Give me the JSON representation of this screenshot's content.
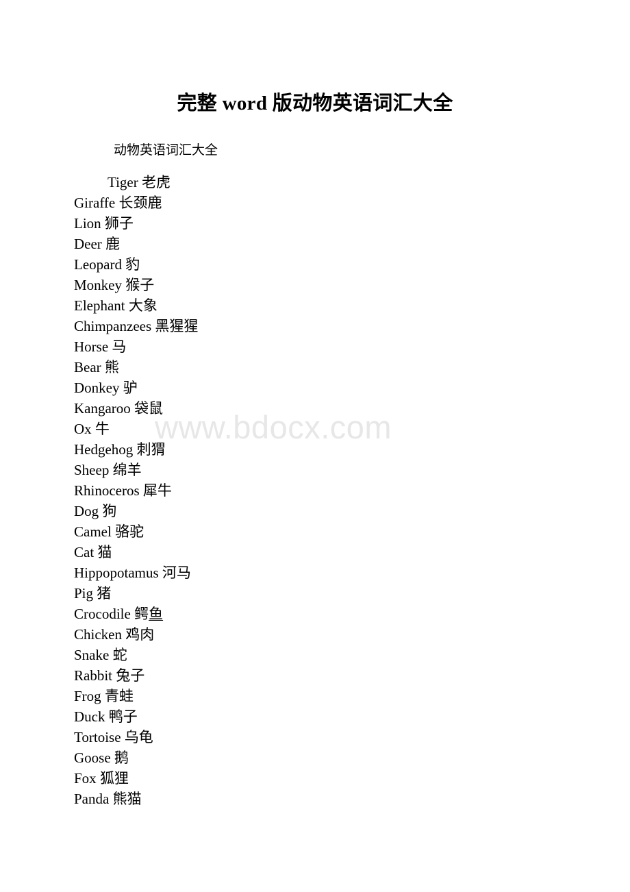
{
  "document": {
    "title": "完整 word 版动物英语词汇大全",
    "subtitle": "动物英语词汇大全",
    "watermark": "www.bdocx.com",
    "watermark_color": "#e7e7e7",
    "text_color": "#000000",
    "page_background": "#ffffff",
    "vocabulary": [
      {
        "english": "Tiger",
        "chinese": "老虎",
        "indented": true
      },
      {
        "english": "Giraffe",
        "chinese": "长颈鹿",
        "indented": false
      },
      {
        "english": "Lion",
        "chinese": "狮子",
        "indented": false
      },
      {
        "english": "Deer",
        "chinese": "鹿",
        "indented": false
      },
      {
        "english": "Leopard",
        "chinese": "豹",
        "indented": false
      },
      {
        "english": "Monkey",
        "chinese": "猴子",
        "indented": false
      },
      {
        "english": "Elephant",
        "chinese": "大象",
        "indented": false
      },
      {
        "english": "Chimpanzees",
        "chinese": "黑猩猩",
        "indented": false
      },
      {
        "english": "Horse",
        "chinese": "马",
        "indented": false
      },
      {
        "english": "Bear",
        "chinese": "熊",
        "indented": false
      },
      {
        "english": "Donkey",
        "chinese": "驴",
        "indented": false
      },
      {
        "english": "Kangaroo",
        "chinese": "袋鼠",
        "indented": false
      },
      {
        "english": "Ox",
        "chinese": "牛",
        "indented": false
      },
      {
        "english": "Hedgehog",
        "chinese": "刺猬",
        "indented": false
      },
      {
        "english": "Sheep",
        "chinese": "绵羊",
        "indented": false
      },
      {
        "english": "Rhinoceros",
        "chinese": "犀牛",
        "indented": false
      },
      {
        "english": "Dog",
        "chinese": "狗",
        "indented": false
      },
      {
        "english": "Camel",
        "chinese": "骆驼",
        "indented": false
      },
      {
        "english": "Cat",
        "chinese": "猫",
        "indented": false
      },
      {
        "english": "Hippopotamus",
        "chinese": "河马",
        "indented": false
      },
      {
        "english": "Pig",
        "chinese": "猪",
        "indented": false
      },
      {
        "english": "Crocodile",
        "chinese": "鳄鱼",
        "chinese_plain": "鳄",
        "chinese_underlined": "鱼",
        "indented": false
      },
      {
        "english": "Chicken",
        "chinese": "鸡肉",
        "indented": false
      },
      {
        "english": "Snake",
        "chinese": "蛇",
        "indented": false
      },
      {
        "english": "Rabbit",
        "chinese": "兔子",
        "indented": false
      },
      {
        "english": "Frog",
        "chinese": "青蛙",
        "indented": false
      },
      {
        "english": "Duck",
        "chinese": "鸭子",
        "indented": false
      },
      {
        "english": "Tortoise",
        "chinese": "乌龟",
        "indented": false
      },
      {
        "english": "Goose",
        "chinese": "鹅",
        "indented": false
      },
      {
        "english": "Fox",
        "chinese": "狐狸",
        "indented": false
      },
      {
        "english": "Panda",
        "chinese": "熊猫",
        "indented": false
      }
    ]
  }
}
